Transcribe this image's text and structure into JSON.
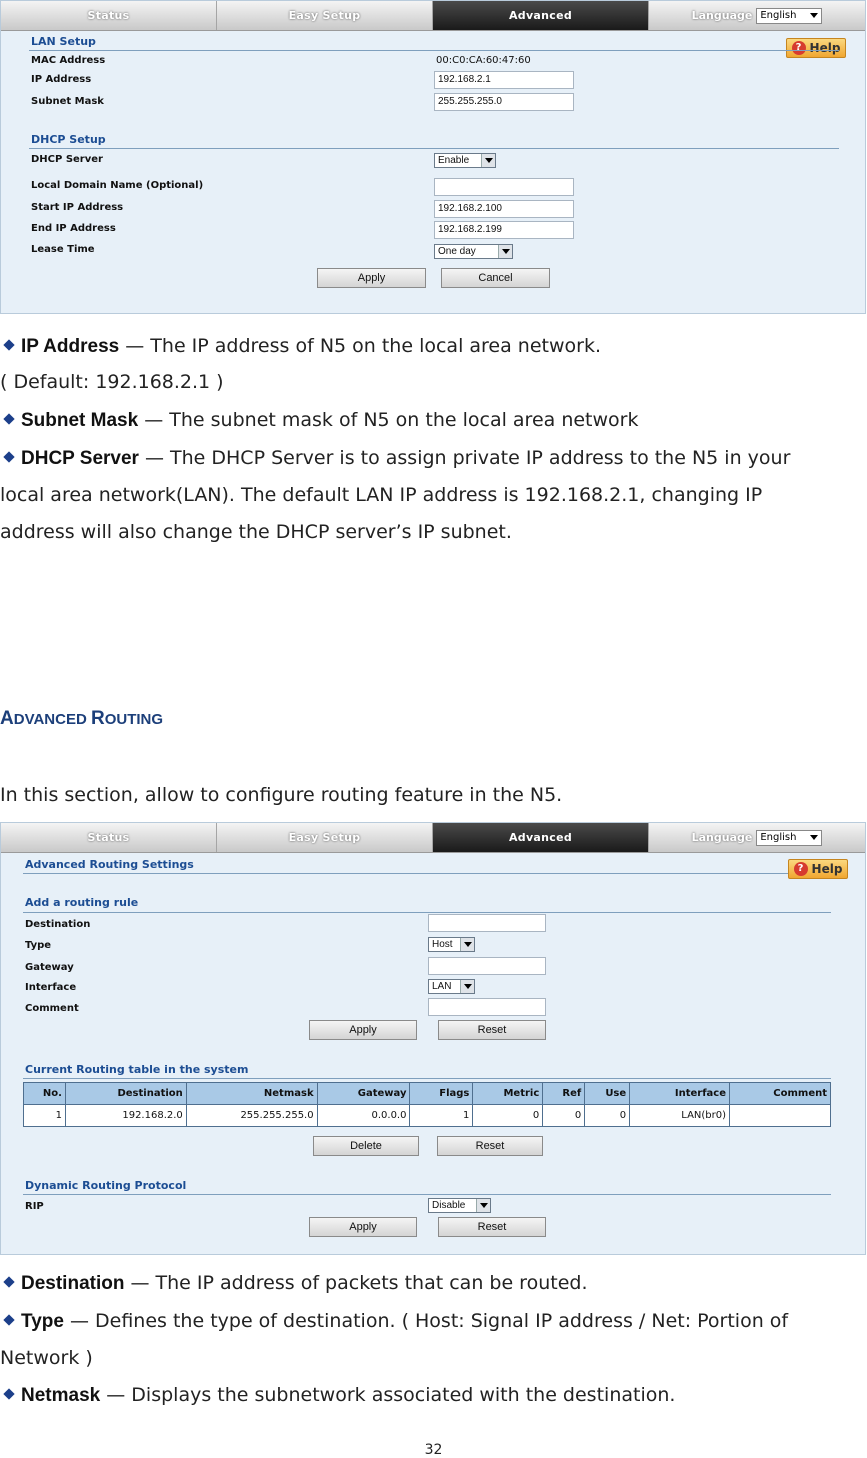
{
  "nav": {
    "tabs": [
      "Status",
      "Easy Setup",
      "Advanced"
    ],
    "language_label": "Language",
    "language_value": "English"
  },
  "help_label": "Help",
  "lan_setup": {
    "title": "LAN Setup",
    "mac_label": "MAC Address",
    "mac_value": "00:C0:CA:60:47:60",
    "ip_label": "IP Address",
    "ip_value": "192.168.2.1",
    "mask_label": "Subnet Mask",
    "mask_value": "255.255.255.0"
  },
  "dhcp_setup": {
    "title": "DHCP Setup",
    "server_label": "DHCP Server",
    "server_value": "Enable",
    "domain_label": "Local Domain Name (Optional)",
    "domain_value": "",
    "start_label": "Start IP Address",
    "start_value": "192.168.2.100",
    "end_label": "End IP Address",
    "end_value": "192.168.2.199",
    "lease_label": "Lease Time",
    "lease_value": "One day",
    "apply": "Apply",
    "cancel": "Cancel"
  },
  "doc1": {
    "ip_term": "IP Address",
    "ip_text": " — The IP address of N5 on the local area network.",
    "ip_default": "( Default: 192.168.2.1 )",
    "mask_term": "Subnet Mask",
    "mask_text": " — The subnet mask of N5 on the local area network",
    "dhcp_term": "DHCP Server",
    "dhcp_text": " — The DHCP Server is to assign private IP address to the N5 in your",
    "dhcp_line2": "local area network(LAN). The default LAN IP address is 192.168.2.1, changing IP",
    "dhcp_line3": "address will also change the DHCP server’s IP subnet."
  },
  "heading": {
    "cap1": "A",
    "rest1": "DVANCED ",
    "cap2": "R",
    "rest2": "OUTING"
  },
  "intro": "In this section, allow to configure routing feature in the N5.",
  "routing": {
    "title": "Advanced Routing Settings",
    "add_title": "Add a routing rule",
    "dest_label": "Destination",
    "type_label": "Type",
    "type_value": "Host",
    "gateway_label": "Gateway",
    "iface_label": "Interface",
    "iface_value": "LAN",
    "comment_label": "Comment",
    "apply": "Apply",
    "reset": "Reset",
    "table_title": "Current Routing table in the system",
    "columns": [
      "No.",
      "Destination",
      "Netmask",
      "Gateway",
      "Flags",
      "Metric",
      "Ref",
      "Use",
      "Interface",
      "Comment"
    ],
    "rows": [
      [
        "1",
        "192.168.2.0",
        "255.255.255.0",
        "0.0.0.0",
        "1",
        "0",
        "0",
        "0",
        "LAN(br0)",
        ""
      ]
    ],
    "delete": "Delete",
    "dyn_title": "Dynamic Routing Protocol",
    "rip_label": "RIP",
    "rip_value": "Disable"
  },
  "doc2": {
    "dest_term": "Destination",
    "dest_text": " — The IP address of packets that can be routed.",
    "type_term": "Type",
    "type_text": " — Defines the type of destination. ( Host: Signal IP address / Net: Portion of",
    "type_line2": "Network )",
    "netmask_term": "Netmask",
    "netmask_text": " — Displays the subnetwork associated with the destination."
  },
  "page_number": "32"
}
